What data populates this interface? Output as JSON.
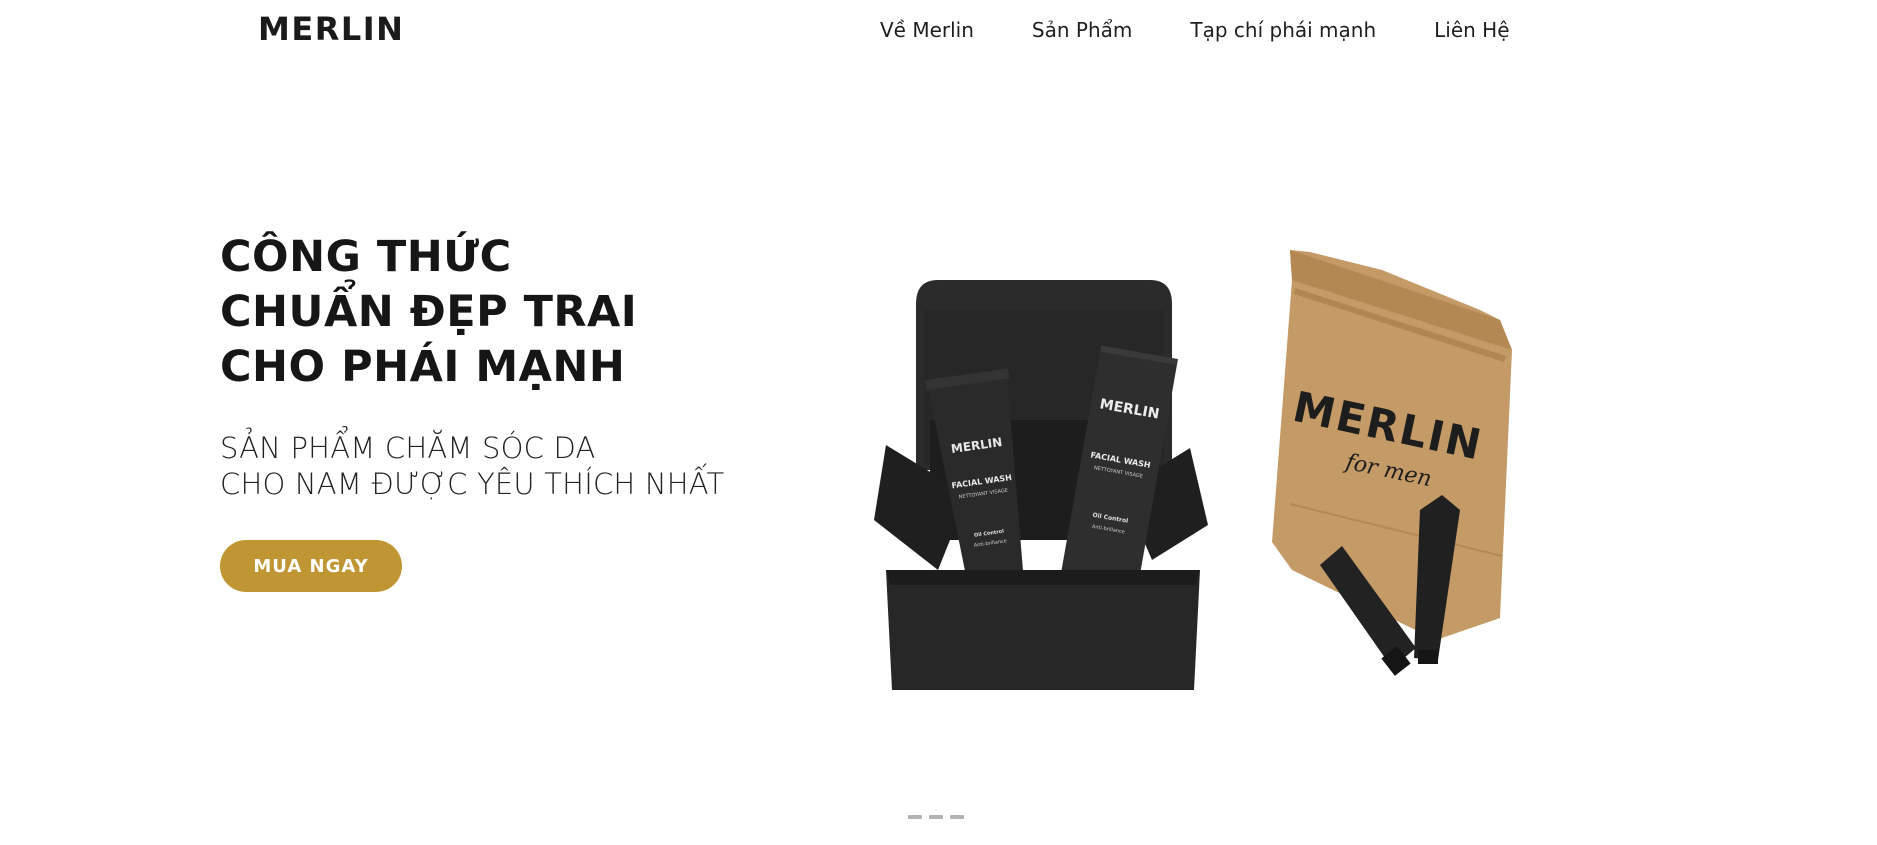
{
  "header": {
    "logo": "MERLIN",
    "nav": [
      {
        "label": "Về Merlin"
      },
      {
        "label": "Sản Phẩm"
      },
      {
        "label": "Tạp chí phái mạnh"
      },
      {
        "label": "Liên Hệ"
      }
    ]
  },
  "hero": {
    "title_lines": [
      "CÔNG THỨC",
      "CHUẨN ĐẸP TRAI",
      "CHO PHÁI MẠNH"
    ],
    "subtitle_lines": [
      "SẢN PHẨM CHĂM SÓC DA",
      "CHO NAM ĐƯỢC YÊU THÍCH NHẤT"
    ],
    "cta_label": "MUA NGAY",
    "image": {
      "bag_brand": "MERLIN",
      "bag_script": "for men",
      "box_tube_brand": "MERLIN",
      "box_tube_product": "FACIAL WASH",
      "box_tube_sub": "NETTOYANT VISAGE",
      "box_tube_feature_1": "Oil Control",
      "box_tube_feature_2": "Anti-brillance",
      "box_carton_brand": "MERLIN",
      "box_carton_product": "FACIAL WASH",
      "box_carton_sub": "NETTOYANT VISAGE",
      "box_carton_feature_1": "Oil Control",
      "box_carton_feature_2": "Anti-brillance"
    }
  },
  "slider": {
    "slide_count": 3,
    "active_slide": 1
  },
  "colors": {
    "accent": "#bf9633",
    "text": "#161616",
    "kraft": "#c49a66",
    "box": "#262626"
  }
}
